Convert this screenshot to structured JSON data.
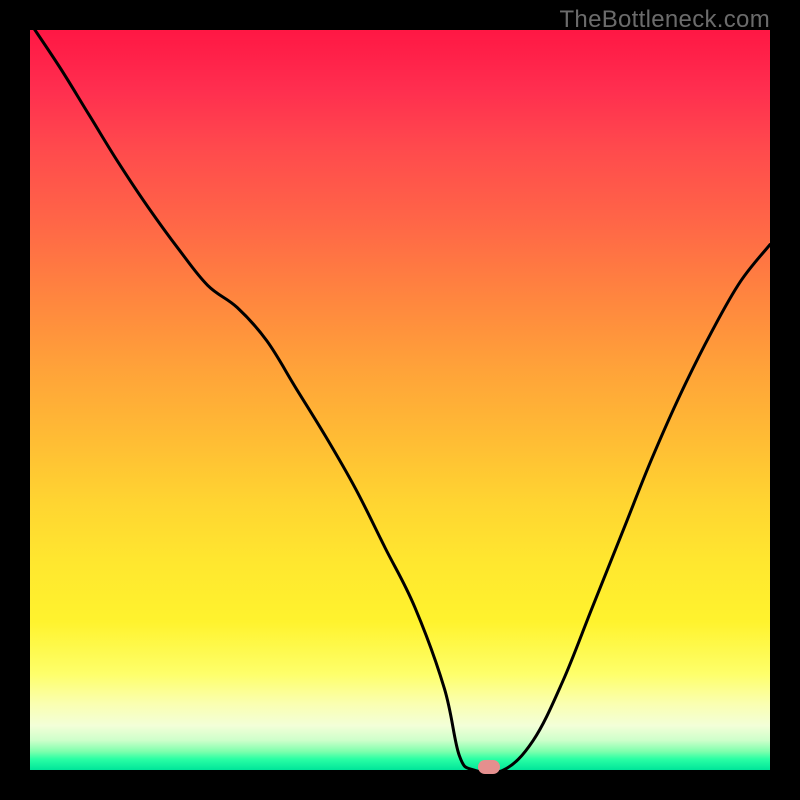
{
  "watermark": "TheBottleneck.com",
  "chart_data": {
    "type": "line",
    "title": "",
    "xlabel": "",
    "ylabel": "",
    "xlim": [
      0,
      100
    ],
    "ylim": [
      0,
      100
    ],
    "grid": false,
    "legend_position": "none",
    "background_gradient": "rainbow (red→yellow→green) indicating bottleneck severity",
    "x": [
      0,
      4,
      8,
      12,
      16,
      20,
      24,
      28,
      32,
      36,
      40,
      44,
      48,
      52,
      56,
      58,
      60,
      64,
      68,
      72,
      76,
      80,
      84,
      88,
      92,
      96,
      100
    ],
    "values": [
      101,
      95,
      88.5,
      82,
      76,
      70.5,
      65.5,
      62.5,
      58,
      51.5,
      45,
      38,
      30,
      22,
      11,
      2,
      0,
      0,
      4,
      12,
      22,
      32,
      42,
      51,
      59,
      66,
      71
    ],
    "marker_position": {
      "x": 62,
      "y": 0
    },
    "marker_color": "#e58f8e",
    "colors": {
      "gradient_top": "#ff1744",
      "gradient_mid": "#ffd531",
      "gradient_bottom": "#00e59a",
      "line": "#000000",
      "frame": "#000000"
    },
    "annotations": [
      "TheBottleneck.com"
    ]
  }
}
